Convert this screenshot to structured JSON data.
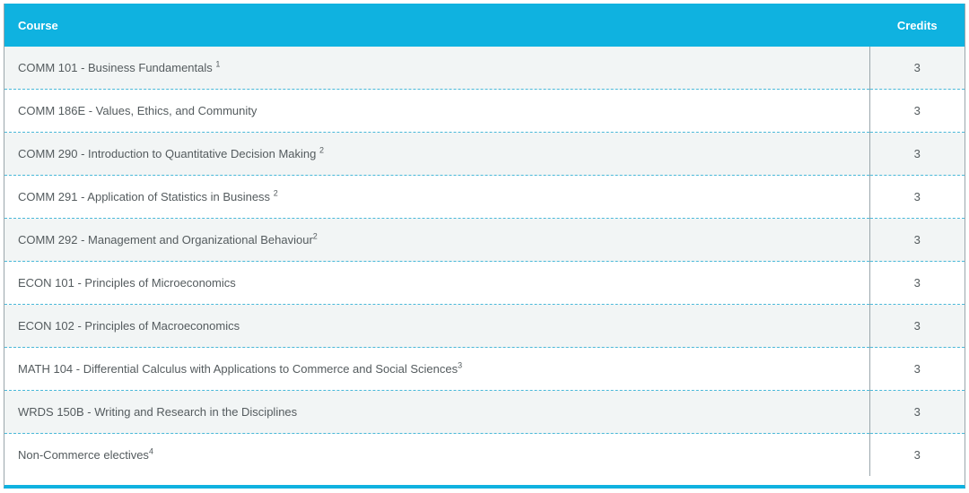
{
  "table": {
    "headers": {
      "course": "Course",
      "credits": "Credits"
    },
    "rows": [
      {
        "course": "COMM 101 - Business Fundamentals ",
        "note": "1",
        "credits": "3"
      },
      {
        "course": "COMM 186E - Values, Ethics, and Community",
        "note": "",
        "credits": "3"
      },
      {
        "course": "COMM 290 - Introduction to Quantitative Decision Making ",
        "note": "2",
        "credits": "3"
      },
      {
        "course": "COMM 291 - Application of Statistics in Business ",
        "note": "2",
        "credits": "3"
      },
      {
        "course": "COMM 292 - Management and Organizational Behaviour",
        "note": "2",
        "credits": "3"
      },
      {
        "course": "ECON 101 - Principles of Microeconomics",
        "note": "",
        "credits": "3"
      },
      {
        "course": "ECON 102 - Principles of Macroeconomics",
        "note": "",
        "credits": "3"
      },
      {
        "course": "MATH 104 - Differential Calculus with Applications to Commerce and Social Sciences",
        "note": "3",
        "credits": "3"
      },
      {
        "course": "WRDS 150B - Writing and Research in the Disciplines",
        "note": "",
        "credits": "3"
      },
      {
        "course": "Non-Commerce electives",
        "note": "4",
        "credits": "3"
      }
    ]
  },
  "colors": {
    "header_bg": "#0fb2e0",
    "header_text": "#ffffff",
    "row_alt_bg": "#f2f5f5",
    "row_text": "#545b5e",
    "divider": "#49b8d8"
  }
}
